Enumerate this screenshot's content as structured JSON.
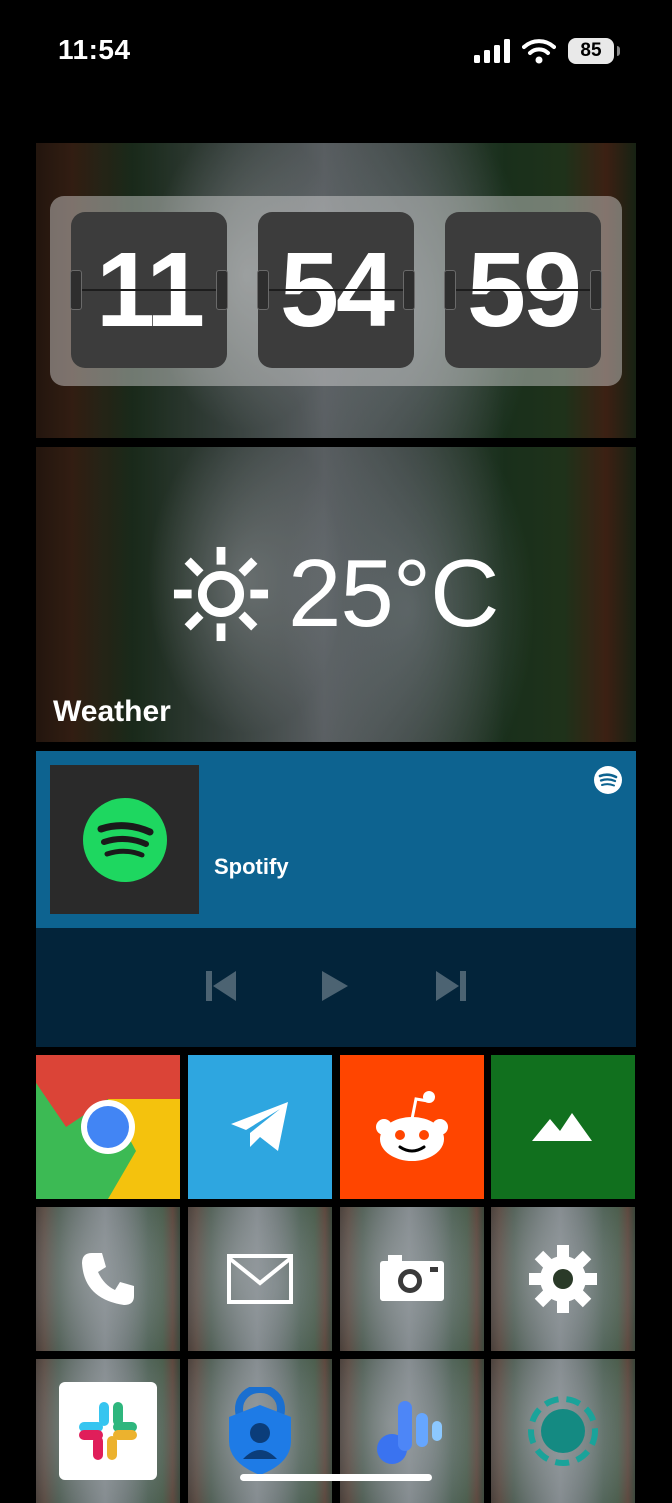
{
  "status_bar": {
    "time": "11:54",
    "battery": "85"
  },
  "clock": {
    "hours": "11",
    "minutes": "54",
    "seconds": "59"
  },
  "weather": {
    "temperature": "25°C",
    "label": "Weather",
    "icon": "sun-icon"
  },
  "spotify": {
    "title": "Spotify",
    "accent": "#1ed760",
    "top_color": "#0d6390",
    "bottom_color": "#03243a"
  },
  "apps": [
    {
      "name": "chrome",
      "icon": "chrome-icon",
      "bg": "#3cba54"
    },
    {
      "name": "telegram",
      "icon": "telegram-icon",
      "bg": "#2ea6e0"
    },
    {
      "name": "reddit",
      "icon": "reddit-icon",
      "bg": "#ff4500"
    },
    {
      "name": "mountains",
      "icon": "mountain-icon",
      "bg": "#11701e"
    },
    {
      "name": "phone",
      "icon": "phone-icon"
    },
    {
      "name": "mail",
      "icon": "mail-icon"
    },
    {
      "name": "camera",
      "icon": "camera-icon"
    },
    {
      "name": "settings",
      "icon": "gear-icon"
    },
    {
      "name": "slack",
      "icon": "slack-icon"
    },
    {
      "name": "authenticator",
      "icon": "authenticator-icon"
    },
    {
      "name": "voice-assistant",
      "icon": "voice-assistant-icon"
    },
    {
      "name": "loading",
      "icon": "dashed-circle-icon"
    }
  ]
}
